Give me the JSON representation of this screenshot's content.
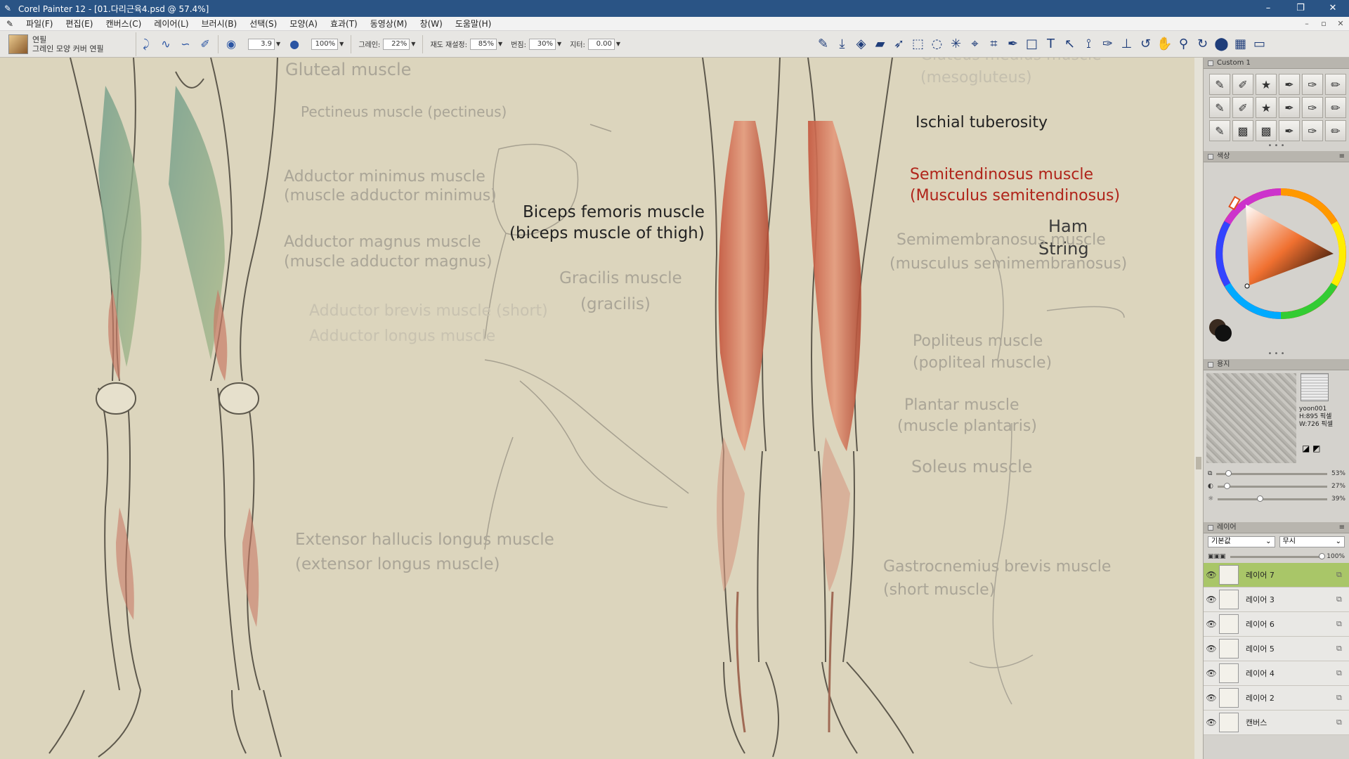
{
  "window": {
    "title": "Corel Painter 12 - [01.다리근육4.psd @ 57.4%]",
    "minimize": "–",
    "restore": "❐",
    "close": "✕"
  },
  "menu": {
    "items": [
      "파일(F)",
      "편집(E)",
      "캔버스(C)",
      "레이어(L)",
      "브러시(B)",
      "선택(S)",
      "모양(A)",
      "효과(T)",
      "동영상(M)",
      "창(W)",
      "도움말(H)"
    ],
    "doc_buttons": [
      "–",
      "▫",
      "✕"
    ]
  },
  "property_bar": {
    "brush_category": "연필",
    "brush_variant": "그레인 모양 커버 연필",
    "size_value": "3.9",
    "opacity_value": "100%",
    "grain_label": "그레인:",
    "grain_value": "22%",
    "resaturation_label": "재도 재설정:",
    "resaturation_value": "85%",
    "bleed_label": "번짐:",
    "bleed_value": "30%",
    "jitter_label": "지터:",
    "jitter_value": "0.00"
  },
  "toolbox": {
    "tools": [
      "brush-tool-icon",
      "dropper-icon",
      "paint-bucket-icon",
      "eraser-icon",
      "layer-adjuster-icon",
      "rect-select-icon",
      "lasso-icon",
      "magic-wand-icon",
      "transform-icon",
      "crop-icon",
      "pen-icon",
      "shape-icon",
      "text-icon",
      "shape-select-icon",
      "divine-proportion-icon",
      "cloner-icon",
      "dodge-icon",
      "mirror-icon",
      "rotate-icon",
      "grabber-icon",
      "magnifier-icon",
      "rotate-page-icon",
      "color-swatch-icon",
      "paper-swatch-icon",
      "screen-mode-icon"
    ]
  },
  "canvas": {
    "labels": [
      {
        "key": "gluteal",
        "text": "Gluteal muscle",
        "tone": "faint"
      },
      {
        "key": "pectineus",
        "text": "Pectineus muscle (pectineus)",
        "tone": "faint"
      },
      {
        "key": "add_min_1",
        "text": "Adductor minimus muscle",
        "tone": "faint"
      },
      {
        "key": "add_min_2",
        "text": "(muscle adductor minimus)",
        "tone": "faint"
      },
      {
        "key": "add_mag_1",
        "text": "Adductor magnus muscle",
        "tone": "faint"
      },
      {
        "key": "add_mag_2",
        "text": "(muscle adductor magnus)",
        "tone": "faint"
      },
      {
        "key": "add_brev",
        "text": "Adductor brevis muscle (short)",
        "tone": "faint"
      },
      {
        "key": "add_long",
        "text": "Adductor longus muscle",
        "tone": "faint"
      },
      {
        "key": "biceps_1",
        "text": "Biceps femoris muscle",
        "tone": "dark"
      },
      {
        "key": "biceps_2",
        "text": "(biceps muscle of thigh)",
        "tone": "dark"
      },
      {
        "key": "gracilis_1",
        "text": "Gracilis muscle",
        "tone": "faint"
      },
      {
        "key": "gracilis_2",
        "text": "(gracilis)",
        "tone": "faint"
      },
      {
        "key": "extensor_1",
        "text": "Extensor hallucis longus muscle",
        "tone": "faint"
      },
      {
        "key": "extensor_2",
        "text": "(extensor longus muscle)",
        "tone": "faint"
      },
      {
        "key": "glut_med_1",
        "text": "Gluteus medius muscle",
        "tone": "faint"
      },
      {
        "key": "glut_med_2",
        "text": "(mesogluteus)",
        "tone": "faint"
      },
      {
        "key": "ischial",
        "text": "Ischial tuberosity",
        "tone": "dark"
      },
      {
        "key": "semiten_1",
        "text": "Semitendinosus muscle",
        "tone": "red"
      },
      {
        "key": "semiten_2",
        "text": "(Musculus semitendinosus)",
        "tone": "red"
      },
      {
        "key": "semimem_1",
        "text": "Semimembranosus muscle",
        "tone": "faint"
      },
      {
        "key": "semimem_2",
        "text": "(musculus semimembranosus)",
        "tone": "faint"
      },
      {
        "key": "popliteus_1",
        "text": "Popliteus muscle",
        "tone": "faint"
      },
      {
        "key": "popliteus_2",
        "text": "(popliteal muscle)",
        "tone": "faint"
      },
      {
        "key": "plantar_1",
        "text": "Plantar muscle",
        "tone": "faint"
      },
      {
        "key": "plantar_2",
        "text": "(muscle plantaris)",
        "tone": "faint"
      },
      {
        "key": "soleus",
        "text": "Soleus muscle",
        "tone": "faint"
      },
      {
        "key": "gastro_1",
        "text": "Gastrocnemius brevis muscle",
        "tone": "faint"
      },
      {
        "key": "gastro_2",
        "text": "(short muscle)",
        "tone": "faint"
      }
    ],
    "handwritten_1": "Ham",
    "handwritten_2": "String"
  },
  "panels": {
    "brush_panel_title": "Custom 1",
    "color_panel_title": "색상",
    "paper_panel_title": "용지",
    "paper_name": "yoon001",
    "paper_height": "H:895 픽셀",
    "paper_width": "W:726 픽셀",
    "paper_scale": "53%",
    "paper_contrast": "27%",
    "paper_brightness": "39%",
    "layers_panel_title": "레이어",
    "composite_method": "기본값",
    "composite_depth": "무시",
    "layer_opacity": "100%",
    "layers": [
      {
        "name": "레이어 7",
        "selected": true
      },
      {
        "name": "레이어 3",
        "selected": false
      },
      {
        "name": "레이어 6",
        "selected": false
      },
      {
        "name": "레이어 5",
        "selected": false
      },
      {
        "name": "레이어 4",
        "selected": false
      },
      {
        "name": "레이어 2",
        "selected": false
      },
      {
        "name": "캔버스",
        "selected": false
      }
    ]
  },
  "colors": {
    "titlebar": "#2a5485",
    "canvas_bg": "#dcd5bd",
    "selected_layer": "#a9c668",
    "label_red": "#b0241a"
  }
}
